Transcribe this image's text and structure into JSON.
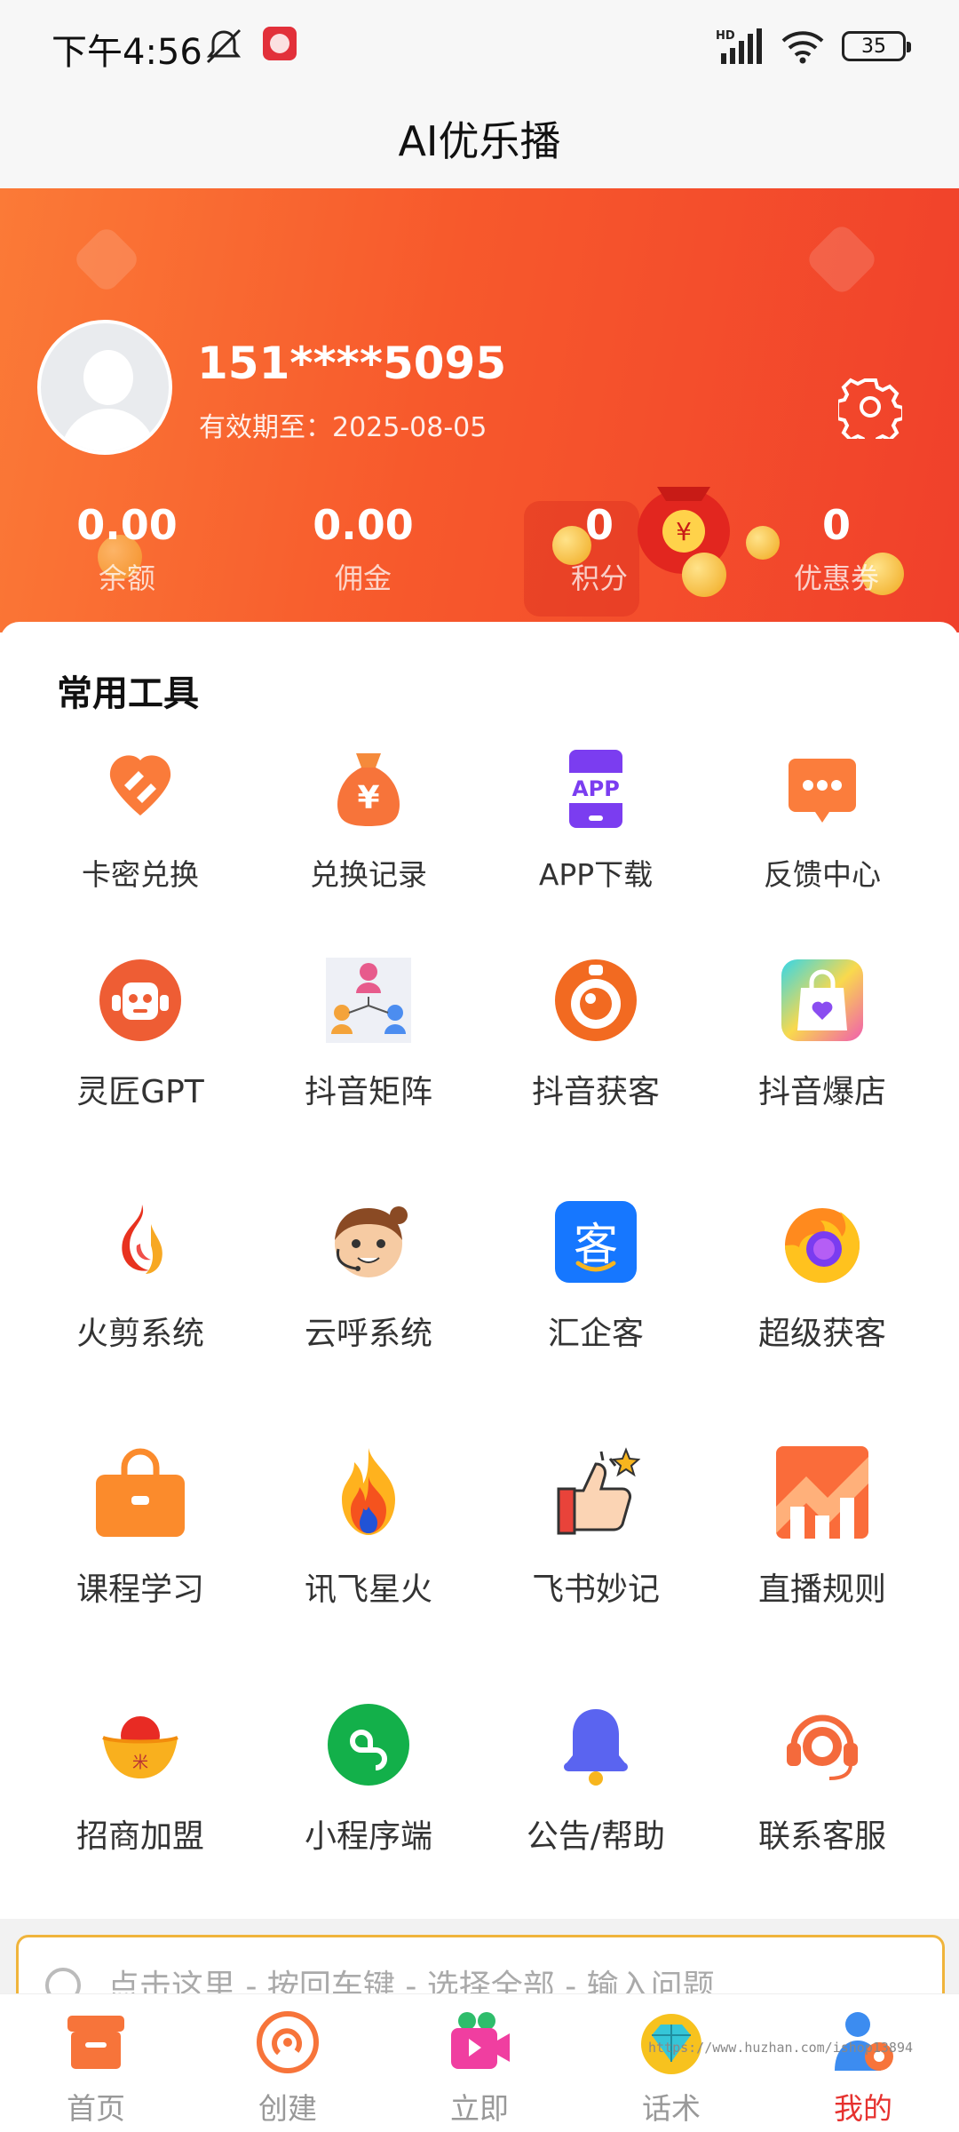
{
  "status_bar": {
    "time": "下午4:56",
    "network": "HD",
    "battery": "35"
  },
  "header": {
    "title": "AI优乐播"
  },
  "profile": {
    "phone": "151****5095",
    "expire": "有效期至：2025-08-05"
  },
  "stats": [
    {
      "value": "0.00",
      "label": "余额"
    },
    {
      "value": "0.00",
      "label": "佣金"
    },
    {
      "value": "0",
      "label": "积分"
    },
    {
      "value": "0",
      "label": "优惠券"
    }
  ],
  "tools": {
    "title": "常用工具",
    "items": [
      {
        "label": "卡密兑换",
        "icon": "card-exchange-icon"
      },
      {
        "label": "兑换记录",
        "icon": "money-bag-icon"
      },
      {
        "label": "APP下载",
        "icon": "app-download-icon"
      },
      {
        "label": "反馈中心",
        "icon": "feedback-icon"
      }
    ]
  },
  "apps": [
    {
      "label": "灵匠GPT",
      "icon": "robot-icon"
    },
    {
      "label": "抖音矩阵",
      "icon": "user-network-icon"
    },
    {
      "label": "抖音获客",
      "icon": "target-icon"
    },
    {
      "label": "抖音爆店",
      "icon": "shopping-bag-icon"
    },
    {
      "label": "火剪系统",
      "icon": "flame-icon"
    },
    {
      "label": "云呼系统",
      "icon": "operator-icon"
    },
    {
      "label": "汇企客",
      "icon": "ke-icon"
    },
    {
      "label": "超级获客",
      "icon": "firefox-icon"
    },
    {
      "label": "课程学习",
      "icon": "bag-icon"
    },
    {
      "label": "讯飞星火",
      "icon": "fire-icon"
    },
    {
      "label": "飞书妙记",
      "icon": "thumbs-up-icon"
    },
    {
      "label": "直播规则",
      "icon": "chart-icon"
    },
    {
      "label": "招商加盟",
      "icon": "gold-ingot-icon"
    },
    {
      "label": "小程序端",
      "icon": "miniprogram-icon"
    },
    {
      "label": "公告/帮助",
      "icon": "bell-icon"
    },
    {
      "label": "联系客服",
      "icon": "headset-icon"
    }
  ],
  "search": {
    "placeholder": "点击这里 - 按回车键 - 选择全部 - 输入问题"
  },
  "bottom_nav": [
    {
      "label": "首页",
      "icon": "home-box-icon",
      "active": false
    },
    {
      "label": "创建",
      "icon": "create-icon",
      "active": false
    },
    {
      "label": "立即",
      "icon": "video-icon",
      "active": false
    },
    {
      "label": "话术",
      "icon": "diamond-icon",
      "active": false
    },
    {
      "label": "我的",
      "icon": "profile-icon",
      "active": true
    }
  ],
  "watermark": "https://www.huzhan.com/ishop13894",
  "colors": {
    "accent": "#f7592c",
    "active_nav": "#e6322f",
    "search_border": "#f0b43b"
  }
}
